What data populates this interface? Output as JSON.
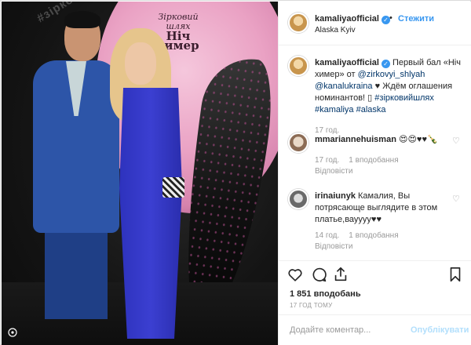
{
  "photo": {
    "moon_text": [
      "Зірковий",
      "шлях",
      "Ніч",
      "химер"
    ],
    "neon_text": "#зірковийшлях"
  },
  "post": {
    "author": "kamaliyaofficial",
    "follow_label": "Стежити",
    "location": "Alaska Kyiv",
    "caption": {
      "text_1": "Первый бал «Ніч химер» от ",
      "mention_1": "@zirkovyi_shlyah",
      "mention_2": "@kanalukraina",
      "text_2": " ♥ Ждём оглашения номинантов! ▯",
      "tags": "#зірковийшлях #kamaliya #alaska",
      "time": "17 год."
    },
    "comments": [
      {
        "user": "mmariannehuisman",
        "text": " 😍😍♥♥🍾",
        "time": "17 год.",
        "likes": "1 вподобання",
        "reply": "Відповісти"
      },
      {
        "user": "irinaiunyk",
        "text": " Камалия, Вы потрясающе выглядите в этом платье,вауууу♥♥",
        "time": "14 год.",
        "likes": "1 вподобання",
        "reply": "Відповісти"
      }
    ],
    "likes_count": "1 851 вподобань",
    "time_ago": "17 ГОД ТОМУ",
    "comment_placeholder": "Додайте коментар...",
    "publish_label": "Опублікувати"
  },
  "icons": [
    "heart-icon",
    "comment-icon",
    "share-icon",
    "bookmark-icon",
    "verified-icon",
    "reel-icon"
  ],
  "colors": {
    "link": "#003569",
    "accent": "#3897f0",
    "publish_disabled": "#b2dffc",
    "muted": "#999999"
  }
}
